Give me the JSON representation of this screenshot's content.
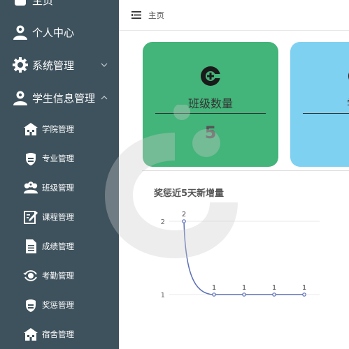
{
  "sidebar": {
    "partial_top_label": "主页",
    "items": [
      {
        "label": "个人中心",
        "icon": "user-icon"
      },
      {
        "label": "系统管理",
        "icon": "gear-icon"
      },
      {
        "label": "学生信息管理",
        "icon": "user-icon"
      }
    ],
    "sub_items": [
      {
        "label": "学院管理",
        "icon": "school-icon"
      },
      {
        "label": "专业管理",
        "icon": "shield-icon"
      },
      {
        "label": "班级管理",
        "icon": "group-icon"
      },
      {
        "label": "课程管理",
        "icon": "edit-icon"
      },
      {
        "label": "成绩管理",
        "icon": "document-icon"
      },
      {
        "label": "考勤管理",
        "icon": "eye-icon"
      },
      {
        "label": "奖惩管理",
        "icon": "shield-icon"
      },
      {
        "label": "宿舍管理",
        "icon": "school-icon"
      }
    ]
  },
  "header": {
    "menu_icon": "menu-icon",
    "breadcrumb": "主页"
  },
  "cards": [
    {
      "title": "班级数量",
      "value": "5",
      "color": "#43b47a",
      "icon": "cart-icon"
    },
    {
      "title": "学院",
      "value": "",
      "color": "#7fd1f2",
      "icon": "cart-icon"
    }
  ],
  "chart_section": {
    "title": "奖惩近5天新增量"
  },
  "chart_data": {
    "type": "line",
    "title": "奖惩近5天新增量",
    "values": [
      2,
      1,
      1,
      1,
      1
    ],
    "ytick_labels": [
      "1",
      "2"
    ],
    "ylim": [
      1,
      2
    ],
    "grid": true,
    "line_color": "#5b6fb5"
  }
}
